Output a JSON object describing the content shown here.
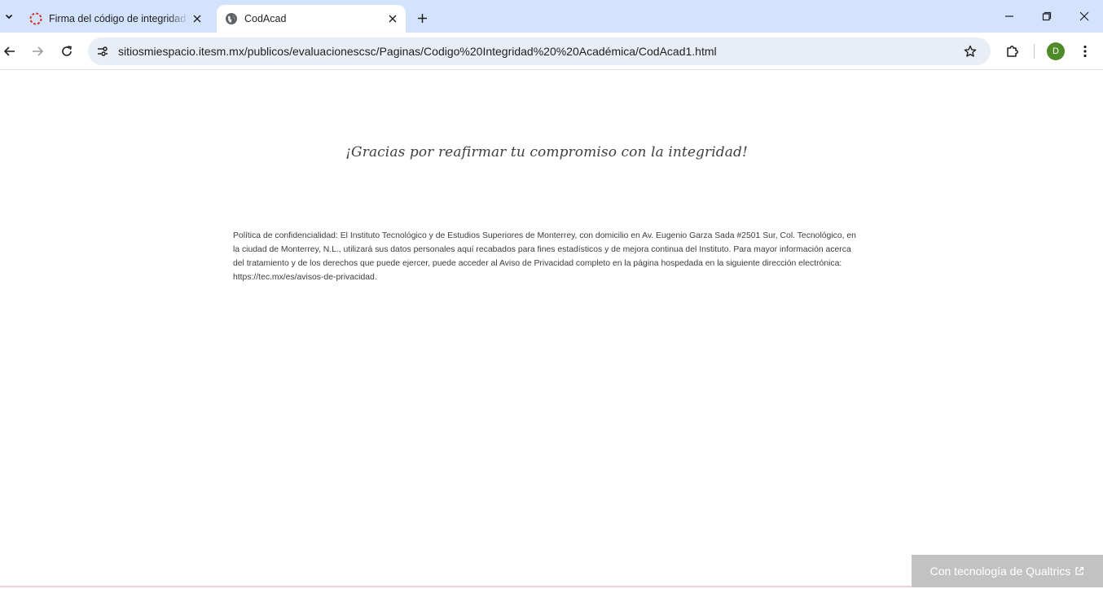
{
  "tabs": [
    {
      "title": "Firma del código de integridad",
      "icon": "loading-spinner-icon",
      "active": false
    },
    {
      "title": "CodAcad",
      "icon": "globe-icon",
      "active": true
    }
  ],
  "address_bar": {
    "url": "sitiosmiespacio.itesm.mx/publicos/evaluacionescsc/Paginas/Codigo%20Integridad%20%20Académica/CodAcad1.html"
  },
  "profile": {
    "initial": "D",
    "color": "#4f8a2a"
  },
  "page": {
    "thanks_message": "¡Gracias por reafirmar tu compromiso con la integridad!",
    "privacy_notice": "Política de confidencialidad: El Instituto Tecnológico y de Estudios Superiores de Monterrey, con domicilio en Av. Eugenio Garza Sada #2501 Sur, Col. Tecnológico, en la ciudad de Monterrey, N.L., utilizará sus datos personales aquí recabados para fines estadísticos y de mejora continua del Instituto. Para mayor información acerca del tratamiento y de los derechos que puede ejercer, puede acceder al Aviso de Privacidad completo en la página hospedada en la siguiente dirección electrónica: https://tec.mx/es/avisos-de-privacidad.",
    "powered_by": "Con tecnología de Qualtrics"
  },
  "colors": {
    "tabstrip": "#d3e3fd",
    "omnibox": "#e9eef6",
    "qualtrics_badge": "#c2c2c2"
  }
}
